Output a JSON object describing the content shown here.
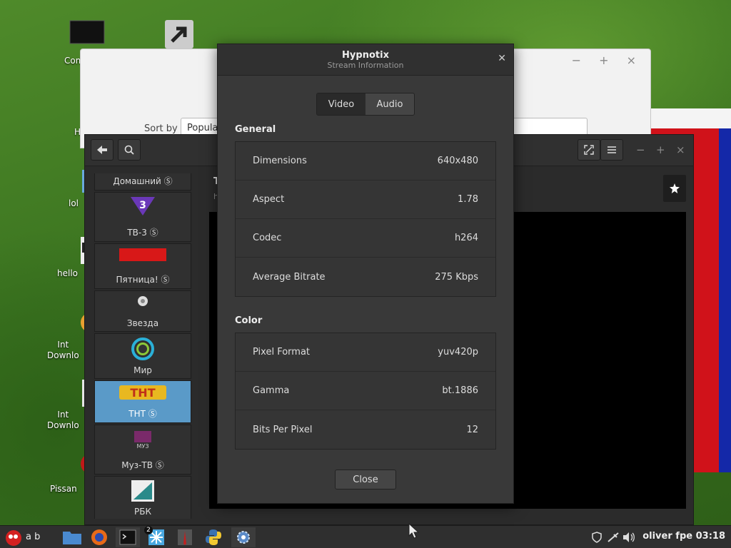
{
  "desktop": {
    "icons": [
      {
        "label": "Com"
      },
      {
        "label": "H"
      },
      {
        "label": "lol"
      },
      {
        "label": "hello"
      },
      {
        "label": "Int\nDownlo"
      },
      {
        "label": "Int\nDownlo"
      },
      {
        "label": "Pissan"
      }
    ]
  },
  "back_window": {
    "sort_label": "Sort by",
    "sort_value": "Popula",
    "search_placeholder": "h"
  },
  "main_window": {
    "title_fragment": "T",
    "subtitle_fragment": "h",
    "channels": [
      {
        "name": "Домашний Ⓢ"
      },
      {
        "name": "ТВ-3 Ⓢ"
      },
      {
        "name": "Пятница! Ⓢ"
      },
      {
        "name": "Звезда"
      },
      {
        "name": "Мир"
      },
      {
        "name": "ТНТ Ⓢ"
      },
      {
        "name": "Муз-ТВ Ⓢ"
      },
      {
        "name": "РБК"
      }
    ]
  },
  "dialog": {
    "title": "Hypnotix",
    "subtitle": "Stream Information",
    "tabs": [
      {
        "label": "Video",
        "active": true
      },
      {
        "label": "Audio",
        "active": false
      }
    ],
    "general": {
      "title": "General",
      "rows": [
        {
          "label": "Dimensions",
          "value": "640x480"
        },
        {
          "label": "Aspect",
          "value": "1.78"
        },
        {
          "label": "Codec",
          "value": "h264"
        },
        {
          "label": "Average Bitrate",
          "value": "275 Kbps"
        }
      ]
    },
    "color": {
      "title": "Color",
      "rows": [
        {
          "label": "Pixel Format",
          "value": "yuv420p"
        },
        {
          "label": "Gamma",
          "value": "bt.1886"
        },
        {
          "label": "Bits Per Pixel",
          "value": "12"
        }
      ]
    },
    "close_label": "Close"
  },
  "taskbar": {
    "keyboard_layout": "a b",
    "badge_count": "2",
    "user_label": "oliver fpe",
    "clock": "03:18"
  },
  "colors": {
    "accent": "#5a9ac8",
    "dialog_bg": "#393939"
  }
}
